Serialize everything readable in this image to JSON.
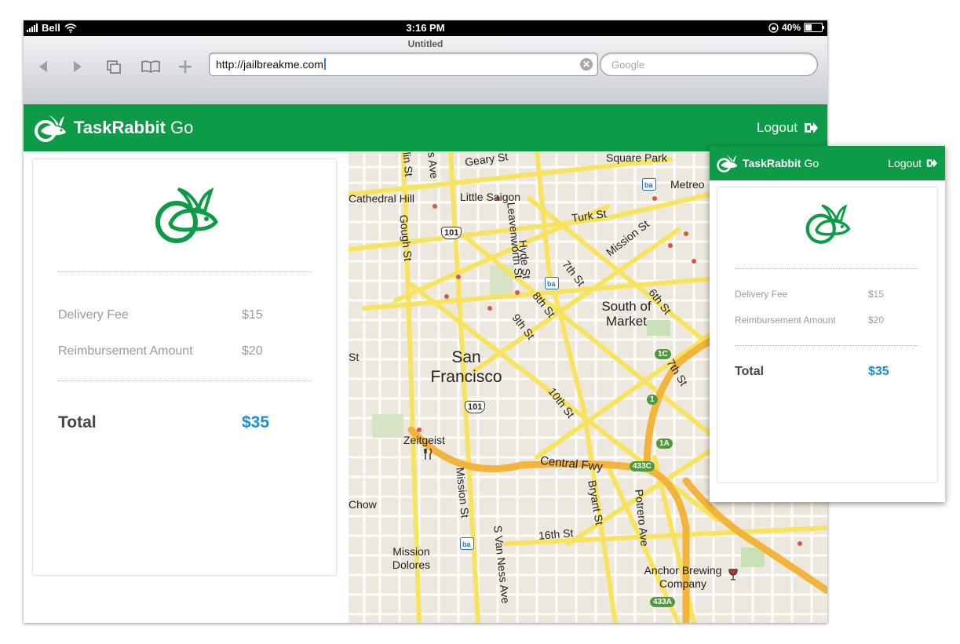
{
  "status_bar": {
    "carrier": "Bell",
    "time": "3:16 PM",
    "battery": "40%"
  },
  "browser": {
    "title": "Untitled",
    "url": "http://jailbreakme.com",
    "search_placeholder": "Google"
  },
  "app": {
    "brand": "TaskRabbit",
    "brand_suffix": "Go",
    "logout_label": "Logout"
  },
  "receipt": {
    "items": [
      {
        "label": "Delivery Fee",
        "amount": "$15"
      },
      {
        "label": "Reimbursement Amount",
        "amount": "$20"
      }
    ],
    "total_label": "Total",
    "total_amount": "$35"
  },
  "map": {
    "labels": [
      "Square Park",
      "Metreo",
      "Geary St",
      "Cathedral Hill",
      "Little Saigon",
      "Leavenworth St",
      "Turk St",
      "Gough St",
      "Hyde St",
      "7th St",
      "Mission St",
      "6th St",
      "South of Market",
      "8th St",
      "9th St",
      "San Francisco",
      "10th St",
      "Zeitgeist",
      "Central Fwy",
      "Mission St",
      "Bryant St",
      "Potrero Ave",
      "16th St",
      "S Van Ness Ave",
      "Chow",
      "Mission Dolores",
      "Anchor Brewing Company",
      "7th St",
      "St",
      "lin St",
      "s Ave"
    ],
    "shields": [
      "101",
      "101"
    ],
    "exits": [
      "1C",
      "1",
      "1A",
      "433C",
      "433A"
    ]
  },
  "colors": {
    "brand_green": "#0d9b48",
    "total_blue": "#1a8fd0"
  }
}
